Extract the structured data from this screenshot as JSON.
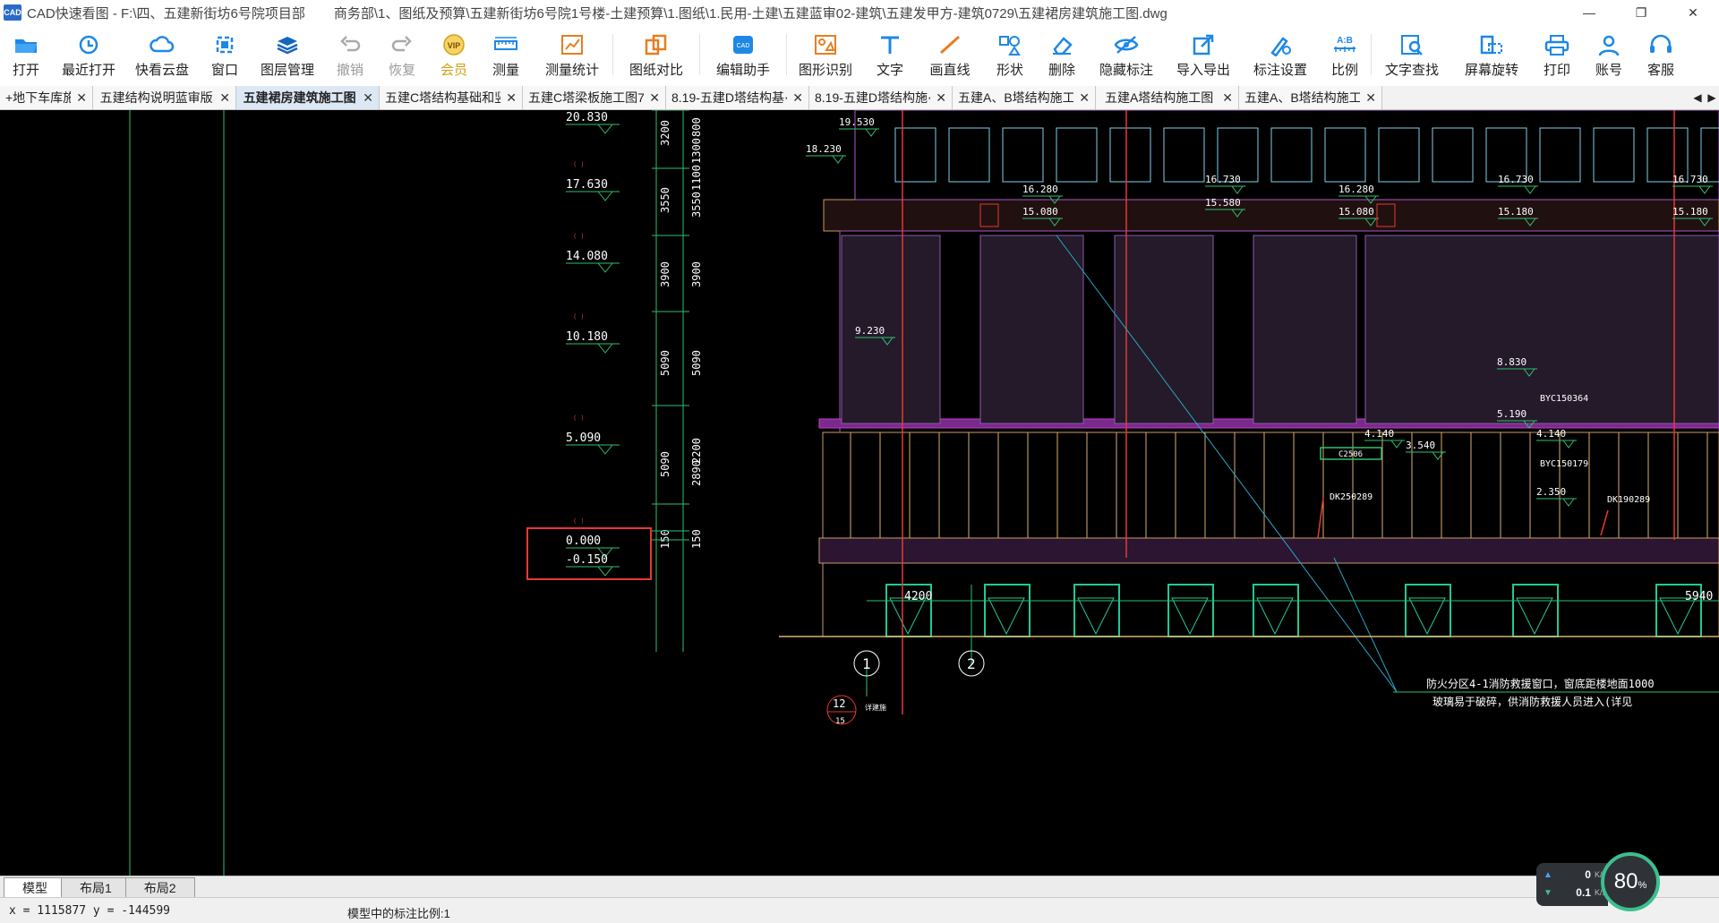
{
  "window": {
    "app_name": "CAD快速看图",
    "title_prefix": "CAD快速看图 - F:\\四、五建新街坊6号院项目部",
    "title_path": "商务部\\1、图纸及预算\\五建新街坊6号院1号楼-土建预算\\1.图纸\\1.民用-土建\\五建蓝审02-建筑\\五建发甲方-建筑0729\\五建裙房建筑施工图.dwg",
    "minimize": "—",
    "restore": "❐",
    "close": "✕"
  },
  "toolbar": [
    {
      "label": "打开",
      "icon": "folder-open-icon"
    },
    {
      "label": "最近打开",
      "icon": "clock-history-icon"
    },
    {
      "label": "快看云盘",
      "icon": "cloud-icon"
    },
    {
      "label": "窗口",
      "icon": "window-icon"
    },
    {
      "label": "图层管理",
      "icon": "layers-icon"
    },
    {
      "label": "撤销",
      "icon": "undo-icon",
      "disabled": true
    },
    {
      "label": "恢复",
      "icon": "redo-icon",
      "disabled": true
    },
    {
      "label": "会员",
      "icon": "vip-icon",
      "vip": true
    },
    {
      "label": "测量",
      "icon": "ruler-icon"
    },
    {
      "label": "测量统计",
      "icon": "measure-stats-icon"
    },
    {
      "label": "图纸对比",
      "icon": "compare-icon"
    },
    {
      "label": "编辑助手",
      "icon": "edit-assistant-icon"
    },
    {
      "label": "图形识别",
      "icon": "shape-recognize-icon"
    },
    {
      "label": "文字",
      "icon": "text-icon"
    },
    {
      "label": "画直线",
      "icon": "line-icon"
    },
    {
      "label": "形状",
      "icon": "shape-icon"
    },
    {
      "label": "删除",
      "icon": "eraser-icon"
    },
    {
      "label": "隐藏标注",
      "icon": "hide-annotation-icon"
    },
    {
      "label": "导入导出",
      "icon": "import-export-icon"
    },
    {
      "label": "标注设置",
      "icon": "annotation-settings-icon"
    },
    {
      "label": "比例",
      "icon": "scale-icon"
    },
    {
      "label": "文字查找",
      "icon": "text-search-icon"
    },
    {
      "label": "屏幕旋转",
      "icon": "rotate-screen-icon"
    },
    {
      "label": "打印",
      "icon": "printer-icon"
    },
    {
      "label": "账号",
      "icon": "account-icon"
    },
    {
      "label": "客服",
      "icon": "headset-icon"
    }
  ],
  "tabs": [
    {
      "label": "+地下车库施⋯",
      "close": "✕",
      "active": false
    },
    {
      "label": "五建结构说明蓝审版",
      "close": "✕",
      "active": false
    },
    {
      "label": "五建裙房建筑施工图",
      "close": "✕",
      "active": true
    },
    {
      "label": "五建C塔结构基础和竖⋯",
      "close": "✕",
      "active": false
    },
    {
      "label": "五建C塔梁板施工图7. ⋯",
      "close": "✕",
      "active": false
    },
    {
      "label": "8.19-五建D塔结构基⋯",
      "close": "✕",
      "active": false
    },
    {
      "label": "8.19-五建D塔结构施⋯",
      "close": "✕",
      "active": false
    },
    {
      "label": "五建A、B塔结构施工图",
      "close": "✕",
      "active": false
    },
    {
      "label": "五建A塔结构施工图",
      "close": "✕",
      "active": false
    },
    {
      "label": "五建A、B塔结构施工图",
      "close": "✕",
      "active": false
    }
  ],
  "tab_nav": {
    "prev": "◀",
    "next": "▶"
  },
  "drawing": {
    "elevations_left": [
      "20.830",
      "17.630",
      "14.080",
      "10.180",
      "5.090",
      "0.000",
      "-0.150"
    ],
    "dims_col1": [
      "3200",
      "3550",
      "3900",
      "5090",
      "5090",
      "150"
    ],
    "dims_col2": [
      "800",
      "1300",
      "1100",
      "3550",
      "3900",
      "5090",
      "2200",
      "2890",
      "150"
    ],
    "elevations_right": [
      "19.530",
      "18.230",
      "16.280",
      "15.080",
      "16.730",
      "15.580",
      "16.280",
      "15.080",
      "16.730",
      "15.180",
      "16.730",
      "15.180",
      "9.230",
      "8.830",
      "5.190",
      "4.140",
      "4.140",
      "3.540",
      "2.350"
    ],
    "tags": [
      "BYC150364",
      "C2506",
      "BYC150179",
      "DK250289",
      "DK190289"
    ],
    "dimension_bottom": [
      "4200",
      "5940"
    ],
    "grid_axes": [
      "1",
      "2",
      "12"
    ],
    "note_line1": "防火分区4-1消防救援窗口，窗底距楼地面1000",
    "note_line2": "玻璃易于破碎，供消防救援人员进入(详见",
    "axis_sub": "15",
    "axis_tag": "详建施"
  },
  "layout_tabs": [
    {
      "label": "模型",
      "active": true
    },
    {
      "label": "布局1",
      "active": false
    },
    {
      "label": "布局2",
      "active": false
    }
  ],
  "status": {
    "coords": "x = 1115877  y = -144599",
    "scale": "模型中的标注比例:1"
  },
  "network": {
    "upload": "0",
    "upload_unit": "K/s",
    "download": "0.1",
    "download_unit": "K/s",
    "percent": "80",
    "percent_unit": "%"
  }
}
